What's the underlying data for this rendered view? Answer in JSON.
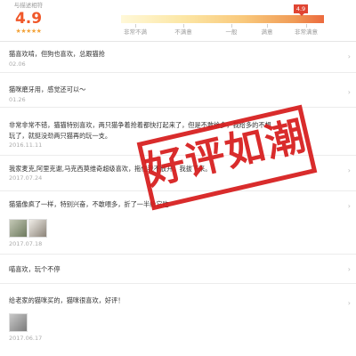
{
  "rating": {
    "caption": "与描述相符",
    "score": "4.9",
    "stars": "★★★★★"
  },
  "scale": {
    "labels": [
      "非常不满",
      "不满意",
      "一般",
      "满意",
      "非常满意"
    ],
    "badge": "4.9"
  },
  "reviews": [
    {
      "text": "猫喜欢啃，但狗也喜欢，总跟猫抢",
      "date": "02.06"
    },
    {
      "text": "猫咪磨牙用，感觉还可以～",
      "date": "01.26"
    },
    {
      "text": "非常非常不错，猫猫特别喜欢，两只猫争着抢着都快打起来了，但是不敢给多，我给多的不想",
      "text2": "玩了，就挺没劲两只猫再的玩一支。",
      "date": "2016.11.11"
    },
    {
      "text": "我家麦克,阿里克谢,马克西莫维奇超级喜欢，拖住我不放开，我拔下来。",
      "date": "2017.07.24"
    },
    {
      "text": "猫猫像疯了一样，特别兴奋，不敢喂多，折了一半给它吃",
      "date": "2017.07.18"
    },
    {
      "text": "喵喜欢，玩个不停",
      "date": ""
    },
    {
      "text": "给老家的猫咪买的，猫咪很喜欢，好评！",
      "date": "2017.06.17"
    }
  ],
  "stamp": {
    "text": "好评如潮"
  },
  "colors": {
    "accent": "#f0582a",
    "stamp": "#d61a1a",
    "badge": "#e04533"
  }
}
